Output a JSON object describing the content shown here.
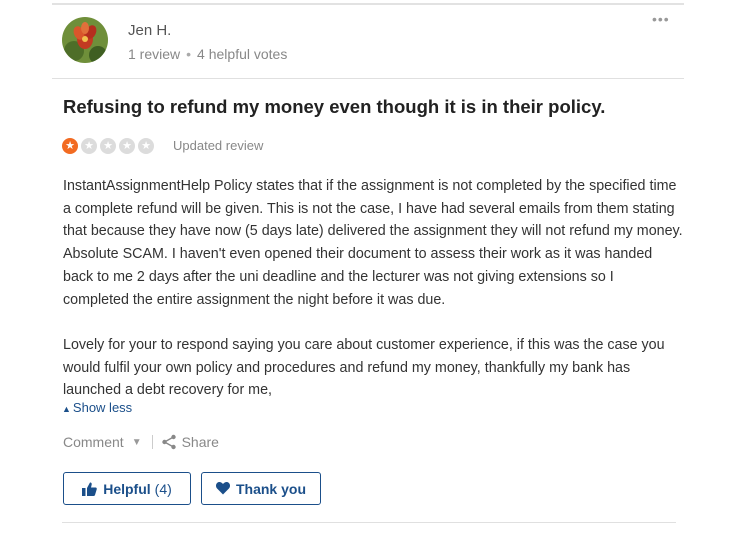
{
  "reviewer": {
    "name": "Jen H.",
    "review_count": "1 review",
    "helpful_votes": "4 helpful votes",
    "separator": "•"
  },
  "menu_icon": "more-dots-icon",
  "review": {
    "title": "Refusing to refund my money even though it is in their policy.",
    "rating": 1,
    "rating_max": 5,
    "status": "Updated review",
    "paragraphs": [
      "InstantAssignmentHelp Policy states that if the assignment is not completed by the specified time a complete refund will be given. This is not the case, I have had several emails from them stating that because they have now (5 days late) delivered the assignment they will not refund my money. Absolute SCAM. I haven't even opened their document to assess their work as it was handed back to me 2 days after the uni deadline and the lecturer was not giving extensions so I completed the entire assignment the night before it was due.",
      "Lovely for your to respond saying you care about customer experience, if this was the case you would fulfil your own policy and procedures and refund my money, thankfully my bank has launched a debt recovery for me,"
    ],
    "show_less": "Show less"
  },
  "actions": {
    "comment": "Comment",
    "share": "Share",
    "helpful_label": "Helpful",
    "helpful_count": "(4)",
    "thank_you": "Thank you"
  },
  "colors": {
    "accent": "#1b4f8a",
    "star_on": "#f26b22",
    "star_off": "#dcdcdc"
  }
}
